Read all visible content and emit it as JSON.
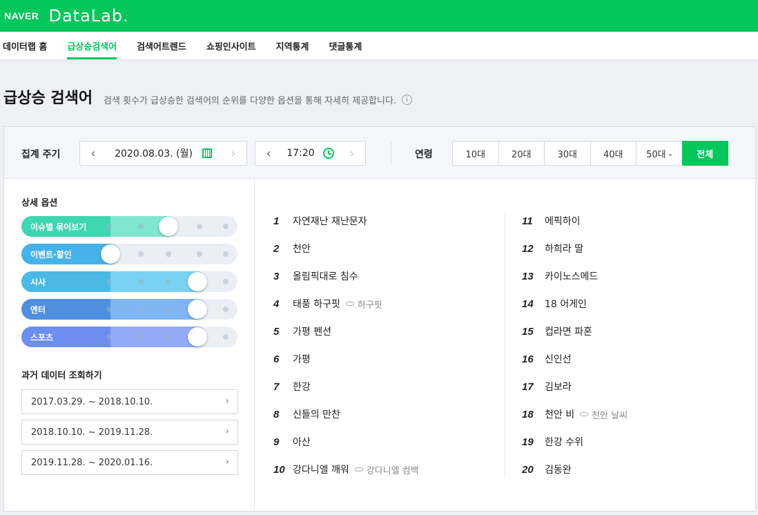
{
  "brand": {
    "naver": "NAVER",
    "datalab": "DataLab."
  },
  "nav": [
    {
      "label": "데이터랩 홈",
      "active": false
    },
    {
      "label": "급상승검색어",
      "active": true
    },
    {
      "label": "검색어트렌드",
      "active": false
    },
    {
      "label": "쇼핑인사이트",
      "active": false
    },
    {
      "label": "지역통계",
      "active": false
    },
    {
      "label": "댓글통계",
      "active": false
    }
  ],
  "page": {
    "title": "급상승 검색어",
    "description": "검색 횟수가 급상승한 검색어의 순위를 다양한 옵션을 통해 자세히 제공합니다.",
    "info": "i"
  },
  "filters": {
    "period_label": "집계 주기",
    "date": "2020.08.03. (월)",
    "time": "17:20",
    "prev": "‹",
    "next": "›",
    "age_label": "연령",
    "ages": [
      {
        "label": "10대",
        "active": false
      },
      {
        "label": "20대",
        "active": false
      },
      {
        "label": "30대",
        "active": false
      },
      {
        "label": "40대",
        "active": false
      },
      {
        "label": "50대 -",
        "active": false
      },
      {
        "label": "전체",
        "active": true
      }
    ]
  },
  "options": {
    "title": "상세 옵션",
    "sliders": [
      {
        "label": "이슈별 묶어보기",
        "level": 0.5,
        "color": "#3fd6b2",
        "fill": "#80e6cf"
      },
      {
        "label": "이벤트·할인",
        "level": 0.0,
        "color": "#45b3e8",
        "fill": "#45b3e8"
      },
      {
        "label": "시사",
        "level": 0.75,
        "color": "#4ab9e6",
        "fill": "#7ad2f3"
      },
      {
        "label": "엔터",
        "level": 0.75,
        "color": "#4f8fdf",
        "fill": "#7fb6f1"
      },
      {
        "label": "스포츠",
        "level": 0.75,
        "color": "#6b8ef0",
        "fill": "#93aaf6"
      }
    ]
  },
  "history": {
    "title": "과거 데이터 조회하기",
    "chevron": "›",
    "ranges": [
      "2017.03.29. ~ 2018.10.10.",
      "2018.10.10. ~ 2019.11.28.",
      "2019.11.28. ~ 2020.01.16."
    ]
  },
  "rankings": [
    {
      "rank": "1",
      "keyword": "자연재난 재난문자",
      "related": ""
    },
    {
      "rank": "2",
      "keyword": "천안",
      "related": ""
    },
    {
      "rank": "3",
      "keyword": "올림픽대로 침수",
      "related": ""
    },
    {
      "rank": "4",
      "keyword": "태풍 하구핏",
      "related": "하구핏"
    },
    {
      "rank": "5",
      "keyword": "가평 펜션",
      "related": ""
    },
    {
      "rank": "6",
      "keyword": "가평",
      "related": ""
    },
    {
      "rank": "7",
      "keyword": "한강",
      "related": ""
    },
    {
      "rank": "8",
      "keyword": "신들의 만찬",
      "related": ""
    },
    {
      "rank": "9",
      "keyword": "아산",
      "related": ""
    },
    {
      "rank": "10",
      "keyword": "강다니엘 깨워",
      "related": "강다니엘 컴백"
    },
    {
      "rank": "11",
      "keyword": "에픽하이",
      "related": ""
    },
    {
      "rank": "12",
      "keyword": "하희라 딸",
      "related": ""
    },
    {
      "rank": "13",
      "keyword": "카이노스메드",
      "related": ""
    },
    {
      "rank": "14",
      "keyword": "18 어게인",
      "related": ""
    },
    {
      "rank": "15",
      "keyword": "컵라면 파혼",
      "related": ""
    },
    {
      "rank": "16",
      "keyword": "신인선",
      "related": ""
    },
    {
      "rank": "17",
      "keyword": "김보라",
      "related": ""
    },
    {
      "rank": "18",
      "keyword": "천안 비",
      "related": "천안 날씨"
    },
    {
      "rank": "19",
      "keyword": "한강 수위",
      "related": ""
    },
    {
      "rank": "20",
      "keyword": "김동완",
      "related": ""
    }
  ]
}
